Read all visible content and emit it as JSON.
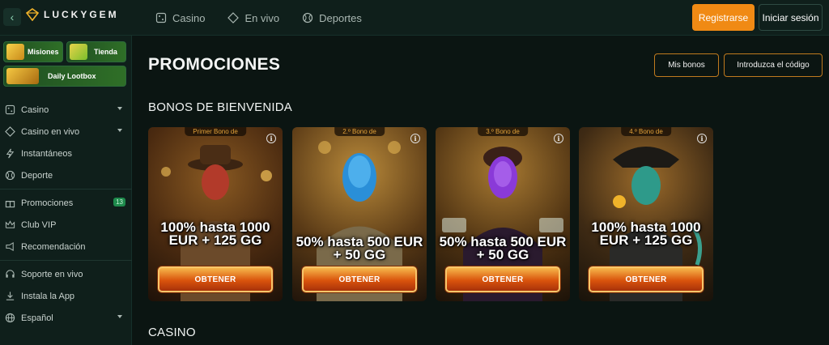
{
  "header": {
    "brand": "LUCKYGEM",
    "nav": [
      {
        "label": "Casino",
        "icon": "dice-icon"
      },
      {
        "label": "En vivo",
        "icon": "diamond-icon"
      },
      {
        "label": "Deportes",
        "icon": "ball-icon"
      }
    ],
    "register_label": "Registrarse",
    "login_label": "Iniciar sesión"
  },
  "sidebar": {
    "tiles": {
      "missions": "Misiones",
      "shop": "Tienda",
      "lootbox": "Daily Lootbox"
    },
    "groups": [
      [
        {
          "label": "Casino",
          "icon": "dice-icon",
          "expandable": true
        },
        {
          "label": "Casino en vivo",
          "icon": "diamond-icon",
          "expandable": true
        },
        {
          "label": "Instantáneos",
          "icon": "bolt-icon"
        },
        {
          "label": "Deporte",
          "icon": "ball-icon"
        }
      ],
      [
        {
          "label": "Promociones",
          "icon": "gift-icon",
          "badge": "13"
        },
        {
          "label": "Club VIP",
          "icon": "crown-icon"
        },
        {
          "label": "Recomendación",
          "icon": "megaphone-icon"
        }
      ],
      [
        {
          "label": "Soporte en vivo",
          "icon": "headset-icon"
        },
        {
          "label": "Instala la App",
          "icon": "download-icon"
        },
        {
          "label": "Español",
          "icon": "globe-icon",
          "expandable": true
        }
      ]
    ]
  },
  "main": {
    "title": "PROMOCIONES",
    "my_bonuses_label": "Mis bonos",
    "enter_code_label": "Introduzca el código",
    "welcome_title": "BONOS DE BIENVENIDA",
    "casino_title": "CASINO",
    "cards": [
      {
        "label": "Primer Bono de",
        "text": "100% hasta 1000 EUR + 125 GG",
        "button": "OBTENER",
        "theme": "explorer"
      },
      {
        "label": "2.º Bono de",
        "text": "50% hasta 500 EUR + 50 GG",
        "button": "OBTENER",
        "theme": "blue"
      },
      {
        "label": "3.º Bono de",
        "text": "50% hasta 500 EUR + 50 GG",
        "button": "OBTENER",
        "theme": "purple"
      },
      {
        "label": "4.º Bono de",
        "text": "100% hasta 1000 EUR + 125 GG",
        "button": "OBTENER",
        "theme": "pirate"
      }
    ]
  },
  "colors": {
    "accent": "#f08a14",
    "background": "#0b1512",
    "panel": "#0f1f1b",
    "badge": "#1e8a4c"
  }
}
